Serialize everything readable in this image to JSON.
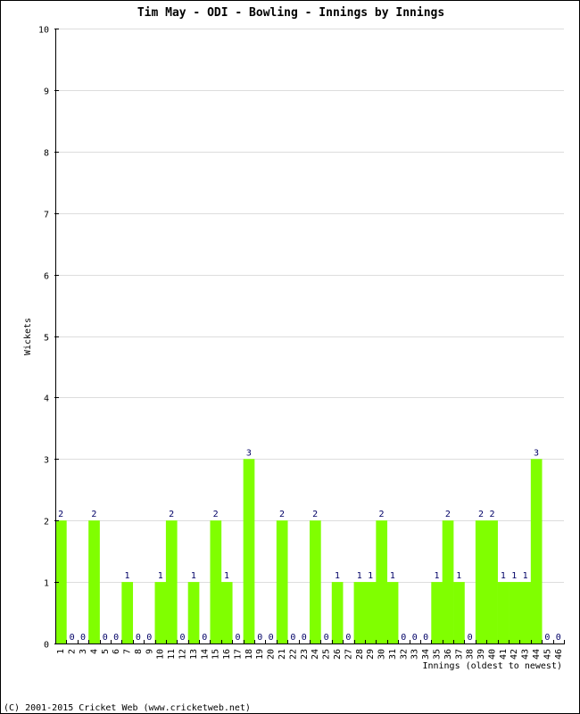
{
  "chart_data": {
    "type": "bar",
    "title": "Tim May - ODI - Bowling - Innings by Innings",
    "xlabel": "Innings (oldest to newest)",
    "ylabel": "Wickets",
    "ylim": [
      0,
      10
    ],
    "yticks": [
      0,
      1,
      2,
      3,
      4,
      5,
      6,
      7,
      8,
      9,
      10
    ],
    "grid": true,
    "bar_color": "#80ff00",
    "value_label_color": "#000066",
    "categories": [
      "1",
      "2",
      "3",
      "4",
      "5",
      "6",
      "7",
      "8",
      "9",
      "10",
      "11",
      "12",
      "13",
      "14",
      "15",
      "16",
      "17",
      "18",
      "19",
      "20",
      "21",
      "22",
      "23",
      "24",
      "25",
      "26",
      "27",
      "28",
      "29",
      "30",
      "31",
      "32",
      "33",
      "34",
      "35",
      "36",
      "37",
      "38",
      "39",
      "40",
      "41",
      "42",
      "43",
      "44",
      "45",
      "46"
    ],
    "values": [
      2,
      0,
      0,
      2,
      0,
      0,
      1,
      0,
      0,
      1,
      2,
      0,
      1,
      0,
      2,
      1,
      0,
      3,
      0,
      0,
      2,
      0,
      0,
      2,
      0,
      1,
      0,
      1,
      1,
      2,
      1,
      0,
      0,
      0,
      1,
      2,
      1,
      0,
      2,
      2,
      1,
      1,
      1,
      3,
      0,
      0
    ]
  },
  "footer": "(C) 2001-2015 Cricket Web (www.cricketweb.net)"
}
